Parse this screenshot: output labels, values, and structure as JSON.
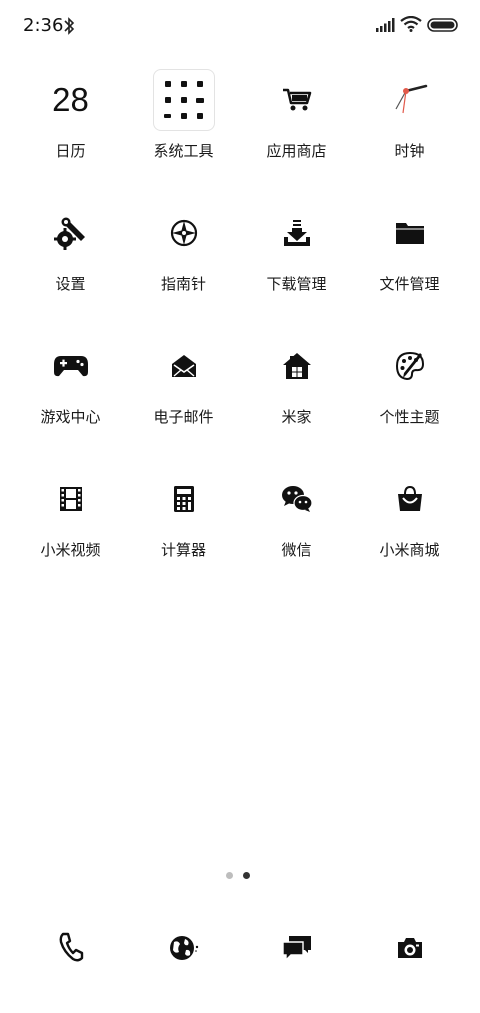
{
  "status": {
    "time": "2:36"
  },
  "apps": [
    {
      "label": "日历",
      "icon": "calendar-date",
      "date": "28"
    },
    {
      "label": "系统工具",
      "icon": "folder"
    },
    {
      "label": "应用商店",
      "icon": "cart-icon"
    },
    {
      "label": "时钟",
      "icon": "clock-icon"
    },
    {
      "label": "设置",
      "icon": "wrench-gear-icon"
    },
    {
      "label": "指南针",
      "icon": "compass-icon"
    },
    {
      "label": "下载管理",
      "icon": "download-tray-icon"
    },
    {
      "label": "文件管理",
      "icon": "folder-icon"
    },
    {
      "label": "游戏中心",
      "icon": "gamepad-icon"
    },
    {
      "label": "电子邮件",
      "icon": "envelope-icon"
    },
    {
      "label": "米家",
      "icon": "home-icon"
    },
    {
      "label": "个性主题",
      "icon": "palette-icon"
    },
    {
      "label": "小米视频",
      "icon": "film-icon"
    },
    {
      "label": "计算器",
      "icon": "calculator-icon"
    },
    {
      "label": "微信",
      "icon": "wechat-icon"
    },
    {
      "label": "小米商城",
      "icon": "shopping-bag-icon"
    }
  ],
  "pager": {
    "pages": 2,
    "current": 2
  },
  "dock": [
    {
      "icon": "phone-icon"
    },
    {
      "icon": "globe-icon"
    },
    {
      "icon": "message-icon"
    },
    {
      "icon": "camera-icon"
    }
  ]
}
